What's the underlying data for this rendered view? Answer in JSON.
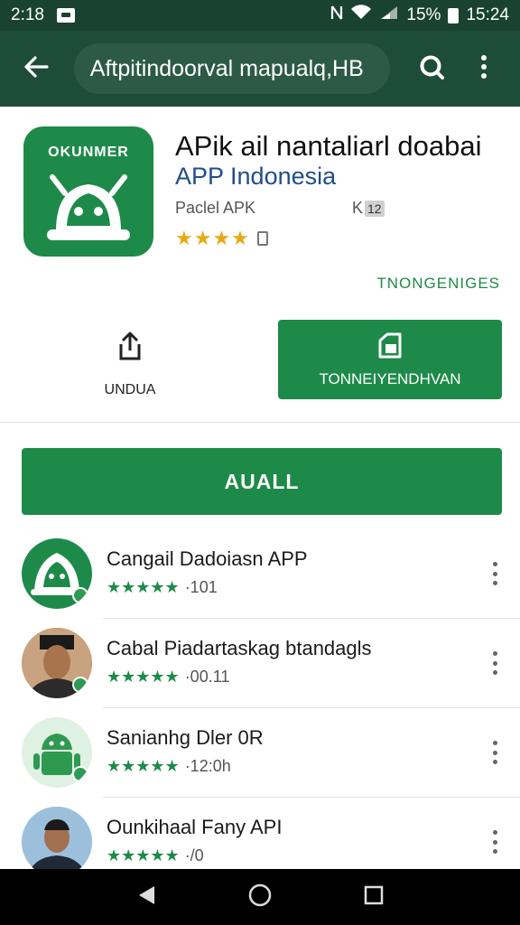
{
  "status_bar": {
    "time_left": "2:18",
    "battery_percent": "15%",
    "time_right": "15:24"
  },
  "app_bar": {
    "search_text": "Aftpitindoorval mapualq,HB",
    "icons": [
      "back-arrow-icon",
      "search-icon",
      "more-vert-icon"
    ]
  },
  "app": {
    "icon_text": "OKUNMER",
    "title": "APik ail nantaliarl doabai",
    "developer": "APP Indonesia",
    "meta_label": "Paclel APK",
    "meta_code": "K",
    "meta_tag": "12",
    "rating_stars": "★★★★",
    "link_text": "TNONGENIGES"
  },
  "actions": {
    "share_label": "UNDUA",
    "primary_label": "TONNEIYENDHVAN"
  },
  "main_button_label": "AUALL",
  "list": [
    {
      "title": "Cangail Dadoiasn APP",
      "stars": "★★★★★",
      "count": "·101"
    },
    {
      "title": "Cabal Piadartaskag btandagls",
      "stars": "★★★★★",
      "count": "·00.11"
    },
    {
      "title": "Sanianhg Dler 0R",
      "stars": "★★★★★",
      "count": "·12:0h"
    },
    {
      "title": "Ounkihaal Fany API",
      "stars": "★★★★★",
      "count": "·/0"
    }
  ],
  "colors": {
    "status_bar": "#1a4232",
    "app_bar": "#1d4d38",
    "accent_green": "#1e8a49",
    "star_gold": "#e8a916",
    "developer_blue": "#1f4e8a"
  }
}
